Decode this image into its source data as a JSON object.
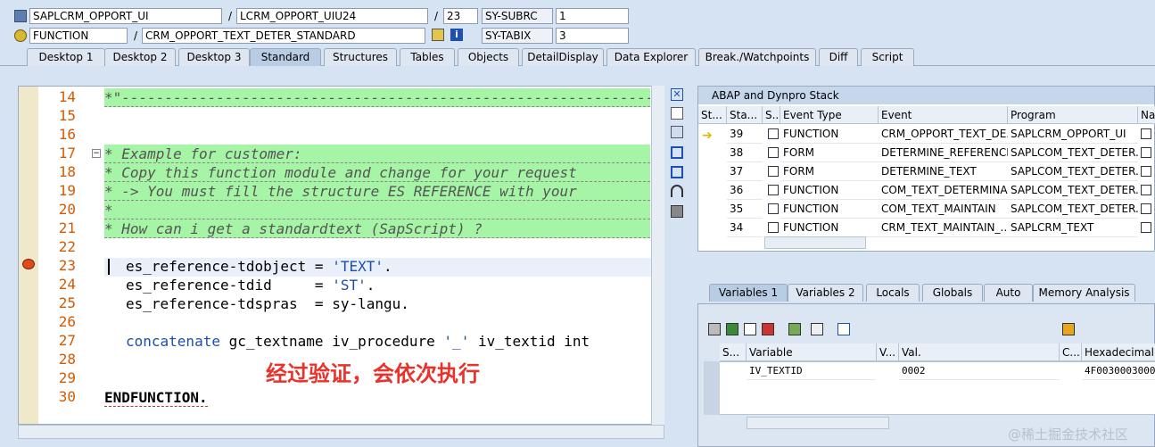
{
  "header": {
    "program": "SAPLCRM_OPPORT_UI",
    "include": "LCRM_OPPORT_UIU24",
    "line": "23",
    "sy_subrc_label": "SY-SUBRC",
    "sy_subrc_value": "1",
    "kind": "FUNCTION",
    "name": "CRM_OPPORT_TEXT_DETER_STANDARD",
    "sy_tabix_label": "SY-TABIX",
    "sy_tabix_value": "3",
    "slash": "/"
  },
  "tabs": [
    "Desktop 1",
    "Desktop 2",
    "Desktop 3",
    "Standard",
    "Structures",
    "Tables",
    "Objects",
    "DetailDisplay",
    "Data Explorer",
    "Break./Watchpoints",
    "Diff",
    "Script"
  ],
  "active_tab": "Standard",
  "code": {
    "lines": [
      {
        "n": "14",
        "text": "*\"------------------------------------------------------------------",
        "type": "comment"
      },
      {
        "n": "15",
        "text": "",
        "type": "blank"
      },
      {
        "n": "16",
        "text": "",
        "type": "blank"
      },
      {
        "n": "17",
        "text": "* Example for customer:",
        "type": "comment"
      },
      {
        "n": "18",
        "text": "* Copy this function module and change for your request",
        "type": "comment"
      },
      {
        "n": "19",
        "text": "* -> You must fill the structure ES REFERENCE with your",
        "type": "comment"
      },
      {
        "n": "20",
        "text": "*",
        "type": "comment"
      },
      {
        "n": "21",
        "text": "* How can i get a standardtext (SapScript) ?",
        "type": "comment"
      },
      {
        "n": "22",
        "text": "",
        "type": "blank"
      },
      {
        "n": "23",
        "text": "es_reference-tdobject = 'TEXT'.",
        "type": "code"
      },
      {
        "n": "24",
        "text": "es_reference-tdid     = 'ST'.",
        "type": "code"
      },
      {
        "n": "25",
        "text": "es_reference-tdspras  = sy-langu.",
        "type": "code"
      },
      {
        "n": "26",
        "text": "",
        "type": "blank"
      },
      {
        "n": "27",
        "text": "concatenate gc_textname iv_procedure '_' iv_textid int",
        "type": "code"
      },
      {
        "n": "28",
        "text": "",
        "type": "blank"
      },
      {
        "n": "29",
        "text": "",
        "type": "blank"
      },
      {
        "n": "30",
        "text": "ENDFUNCTION.",
        "type": "end"
      }
    ],
    "overlay": "经过验证，会依次执行"
  },
  "stack": {
    "title": "ABAP and Dynpro Stack",
    "columns": [
      "St...",
      "Sta...",
      "S...",
      "Event Type",
      "Event",
      "Program",
      "Na..."
    ],
    "rows": [
      {
        "stack": "39",
        "etype": "FUNCTION",
        "event": "CRM_OPPORT_TEXT_DE...",
        "program": "SAPLCRM_OPPORT_UI",
        "current": true
      },
      {
        "stack": "38",
        "etype": "FORM",
        "event": "DETERMINE_REFERENCE...",
        "program": "SAPLCOM_TEXT_DETER...",
        "current": false
      },
      {
        "stack": "37",
        "etype": "FORM",
        "event": "DETERMINE_TEXT",
        "program": "SAPLCOM_TEXT_DETER...",
        "current": false
      },
      {
        "stack": "36",
        "etype": "FUNCTION",
        "event": "COM_TEXT_DETERMINA...",
        "program": "SAPLCOM_TEXT_DETER...",
        "current": false
      },
      {
        "stack": "35",
        "etype": "FUNCTION",
        "event": "COM_TEXT_MAINTAIN",
        "program": "SAPLCOM_TEXT_DETER...",
        "current": false
      },
      {
        "stack": "34",
        "etype": "FUNCTION",
        "event": "CRM_TEXT_MAINTAIN_...",
        "program": "SAPLCRM_TEXT",
        "current": false
      }
    ]
  },
  "var_tabs": [
    "Variables 1",
    "Variables 2",
    "Locals",
    "Globals",
    "Auto",
    "Memory Analysis"
  ],
  "active_var_tab": "Variables 1",
  "vars": {
    "columns": [
      "S...",
      "Variable",
      "V...",
      "Val.",
      "C...",
      "Hexadecimal Va"
    ],
    "rows": [
      {
        "variable": "IV_TEXTID",
        "value": "0002",
        "hex": "4F0030003000"
      }
    ]
  },
  "watermark": "@稀土掘金技术社区",
  "colors": {
    "comment_bg": "#a6f4a6",
    "line_no": "#d65a00",
    "keyword": "#1c4fa8",
    "overlay": "#e8322a",
    "panel_bg": "#d6e3f2"
  }
}
